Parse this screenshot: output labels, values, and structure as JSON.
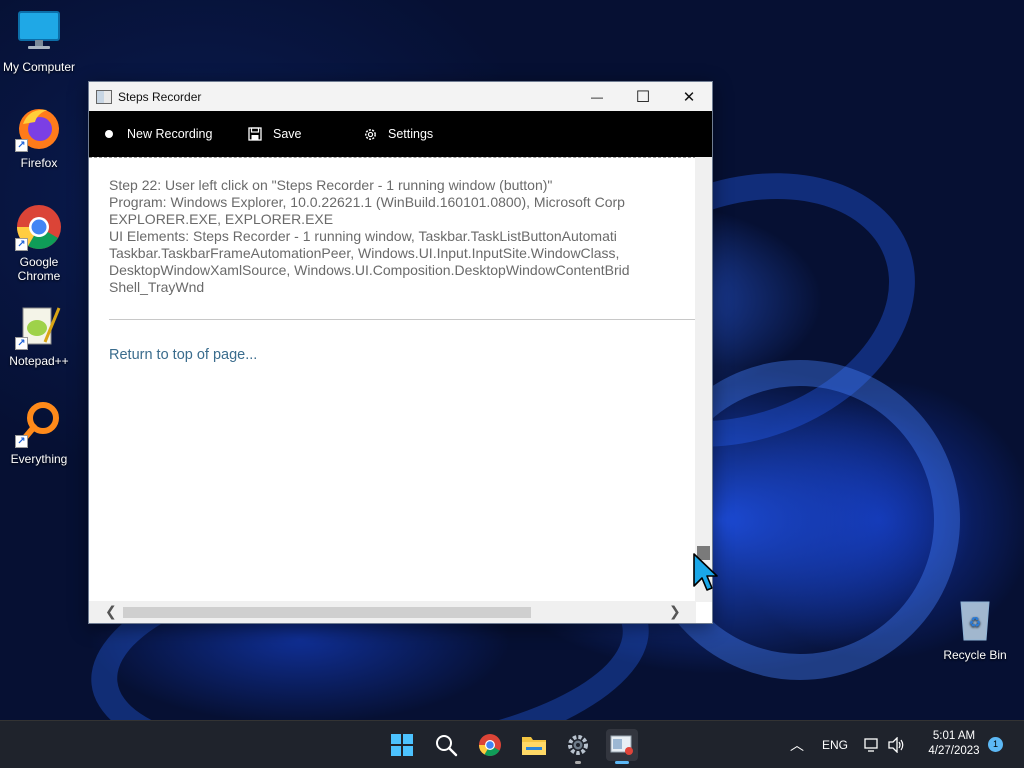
{
  "desktop": {
    "icons": [
      {
        "label": "My Computer"
      },
      {
        "label": "Firefox"
      },
      {
        "label": "Google Chrome"
      },
      {
        "label": "Notepad++"
      },
      {
        "label": "Everything"
      },
      {
        "label": "Recycle Bin"
      }
    ]
  },
  "window": {
    "title": "Steps Recorder",
    "controls": {
      "minimize": "—",
      "maximize": "☐",
      "close": "✕"
    },
    "toolbar": {
      "new_recording": "New Recording",
      "save": "Save",
      "settings": "Settings"
    },
    "content": {
      "lines": [
        "Step 22: User left click on \"Steps Recorder - 1 running window (button)\"",
        "Program: Windows Explorer, 10.0.22621.1 (WinBuild.160101.0800), Microsoft Corp",
        "EXPLORER.EXE, EXPLORER.EXE",
        "UI Elements: Steps Recorder - 1 running window, Taskbar.TaskListButtonAutomati",
        "Taskbar.TaskbarFrameAutomationPeer, Windows.UI.Input.InputSite.WindowClass,",
        "DesktopWindowXamlSource, Windows.UI.Composition.DesktopWindowContentBrid",
        "Shell_TrayWnd"
      ],
      "return_link": "Return to top of page..."
    }
  },
  "taskbar": {
    "tray": {
      "language": "ENG",
      "time": "5:01 AM",
      "date": "4/27/2023",
      "notification_count": "1"
    }
  }
}
